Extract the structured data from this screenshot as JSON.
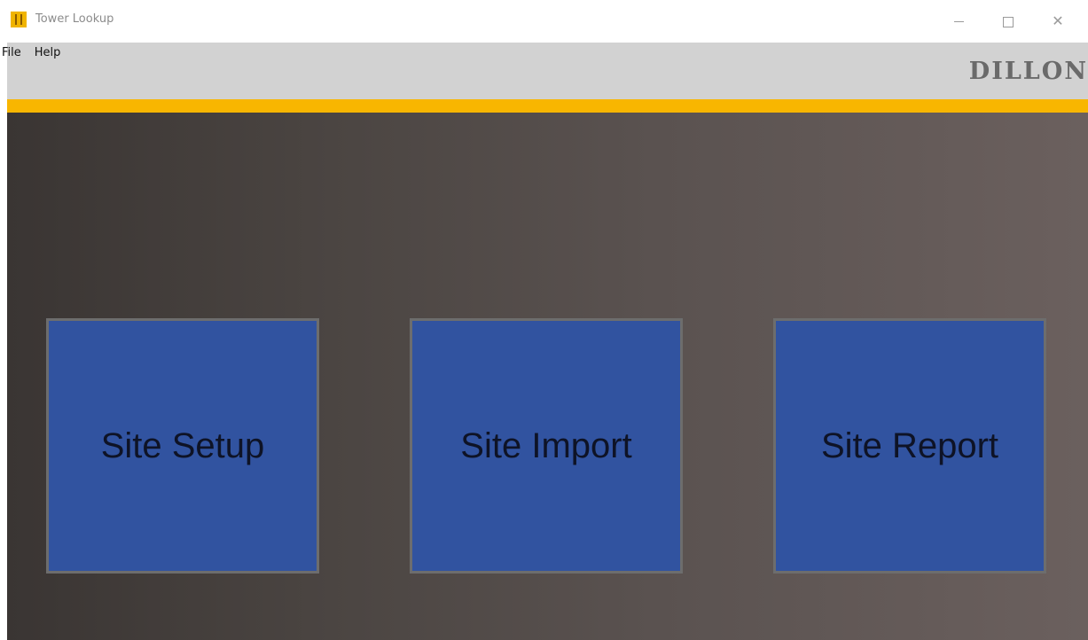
{
  "window": {
    "title": "Tower Lookup",
    "controls": {
      "minimize": "minimize-icon",
      "maximize": "maximize-icon",
      "close": "close-icon",
      "close_glyph": "✕"
    }
  },
  "menu": {
    "items": [
      {
        "label": "File"
      },
      {
        "label": "Help"
      }
    ]
  },
  "brand": {
    "logo_text": "DILLON"
  },
  "tiles": [
    {
      "label": "Site Setup"
    },
    {
      "label": "Site Import"
    },
    {
      "label": "Site Report"
    }
  ],
  "colors": {
    "accent_stripe": "#f8b600",
    "tile_background": "#3153a0",
    "tile_border": "#6d6d6d",
    "header_band": "#d2d2d2",
    "main_gradient_start": "#3a3533",
    "main_gradient_end": "#6b605e"
  }
}
